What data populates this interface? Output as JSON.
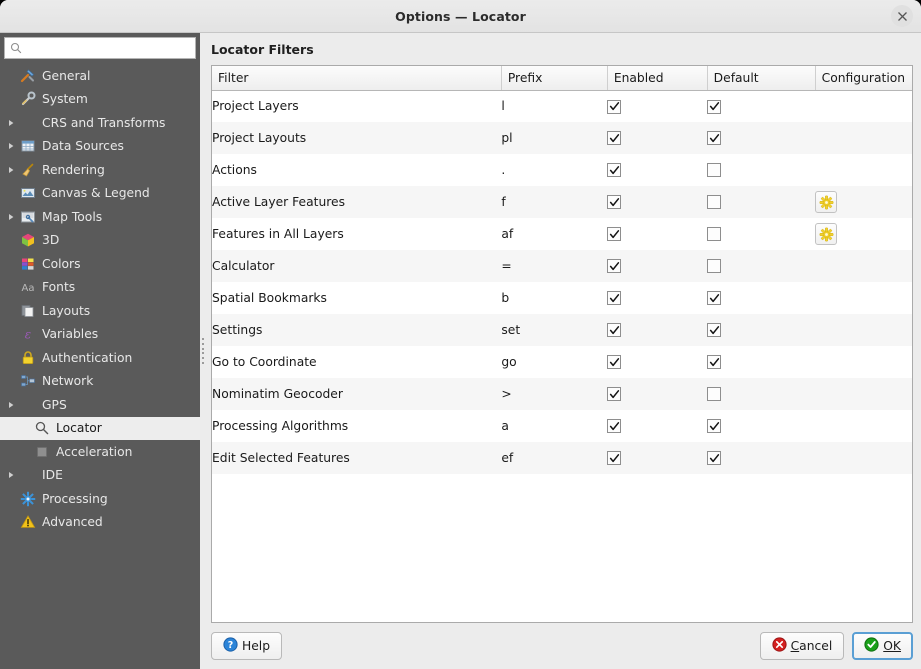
{
  "window": {
    "title": "Options — Locator",
    "close_icon": "close-icon"
  },
  "sidebar": {
    "search": {
      "value": "",
      "placeholder": "",
      "icon": "search-icon"
    },
    "items": [
      {
        "label": "General",
        "icon": "hammer-wrench-icon",
        "arrow": false,
        "indent": 0,
        "selected": false
      },
      {
        "label": "System",
        "icon": "system-tools-icon",
        "arrow": false,
        "indent": 0,
        "selected": false
      },
      {
        "label": "CRS and Transforms",
        "icon": "none",
        "arrow": true,
        "indent": 0,
        "selected": false
      },
      {
        "label": "Data Sources",
        "icon": "table-icon",
        "arrow": true,
        "indent": 0,
        "selected": false
      },
      {
        "label": "Rendering",
        "icon": "broom-icon",
        "arrow": true,
        "indent": 0,
        "selected": false
      },
      {
        "label": "Canvas & Legend",
        "icon": "canvas-icon",
        "arrow": false,
        "indent": 0,
        "selected": false
      },
      {
        "label": "Map Tools",
        "icon": "map-tools-icon",
        "arrow": true,
        "indent": 0,
        "selected": false
      },
      {
        "label": "3D",
        "icon": "cube-3d-icon",
        "arrow": false,
        "indent": 0,
        "selected": false
      },
      {
        "label": "Colors",
        "icon": "color-swatch-icon",
        "arrow": false,
        "indent": 0,
        "selected": false
      },
      {
        "label": "Fonts",
        "icon": "font-aa-icon",
        "arrow": false,
        "indent": 0,
        "selected": false
      },
      {
        "label": "Layouts",
        "icon": "layout-page-icon",
        "arrow": false,
        "indent": 0,
        "selected": false
      },
      {
        "label": "Variables",
        "icon": "epsilon-icon",
        "arrow": false,
        "indent": 0,
        "selected": false
      },
      {
        "label": "Authentication",
        "icon": "lock-icon",
        "arrow": false,
        "indent": 0,
        "selected": false
      },
      {
        "label": "Network",
        "icon": "network-icon",
        "arrow": false,
        "indent": 0,
        "selected": false
      },
      {
        "label": "GPS",
        "icon": "none",
        "arrow": true,
        "indent": 0,
        "selected": false
      },
      {
        "label": "Locator",
        "icon": "search-icon",
        "arrow": false,
        "indent": 1,
        "selected": true
      },
      {
        "label": "Acceleration",
        "icon": "chip-icon",
        "arrow": false,
        "indent": 1,
        "selected": false
      },
      {
        "label": "IDE",
        "icon": "none",
        "arrow": true,
        "indent": 0,
        "selected": false
      },
      {
        "label": "Processing",
        "icon": "gear-blue-icon",
        "arrow": false,
        "indent": 0,
        "selected": false
      },
      {
        "label": "Advanced",
        "icon": "warning-icon",
        "arrow": false,
        "indent": 0,
        "selected": false
      }
    ]
  },
  "main": {
    "title": "Locator Filters",
    "table": {
      "columns": [
        "Filter",
        "Prefix",
        "Enabled",
        "Default",
        "Configuration"
      ],
      "rows": [
        {
          "filter": "Project Layers",
          "prefix": "l",
          "enabled": true,
          "default": true,
          "config": false
        },
        {
          "filter": "Project Layouts",
          "prefix": "pl",
          "enabled": true,
          "default": true,
          "config": false
        },
        {
          "filter": "Actions",
          "prefix": ".",
          "enabled": true,
          "default": false,
          "config": false
        },
        {
          "filter": "Active Layer Features",
          "prefix": "f",
          "enabled": true,
          "default": false,
          "config": true
        },
        {
          "filter": "Features in All Layers",
          "prefix": "af",
          "enabled": true,
          "default": false,
          "config": true
        },
        {
          "filter": "Calculator",
          "prefix": "=",
          "enabled": true,
          "default": false,
          "config": false
        },
        {
          "filter": "Spatial Bookmarks",
          "prefix": "b",
          "enabled": true,
          "default": true,
          "config": false
        },
        {
          "filter": "Settings",
          "prefix": "set",
          "enabled": true,
          "default": true,
          "config": false
        },
        {
          "filter": "Go to Coordinate",
          "prefix": "go",
          "enabled": true,
          "default": true,
          "config": false
        },
        {
          "filter": "Nominatim Geocoder",
          "prefix": ">",
          "enabled": true,
          "default": false,
          "config": false
        },
        {
          "filter": "Processing Algorithms",
          "prefix": "a",
          "enabled": true,
          "default": true,
          "config": false
        },
        {
          "filter": "Edit Selected Features",
          "prefix": "ef",
          "enabled": true,
          "default": true,
          "config": false
        }
      ],
      "config_icon": "gear-yellow-icon"
    }
  },
  "footer": {
    "help_label": "Help",
    "help_icon": "help-blue-icon",
    "cancel_label": "Cancel",
    "cancel_icon": "cancel-red-icon",
    "ok_label": "OK",
    "ok_icon": "ok-green-icon"
  },
  "colors": {
    "sidebar_bg": "#5a5a5a",
    "dialog_bg": "#ececec",
    "accent_blue": "#5a9fd4",
    "gear_yellow": "#f2d12e",
    "ok_green": "#1aa01a",
    "cancel_red": "#d42020"
  }
}
